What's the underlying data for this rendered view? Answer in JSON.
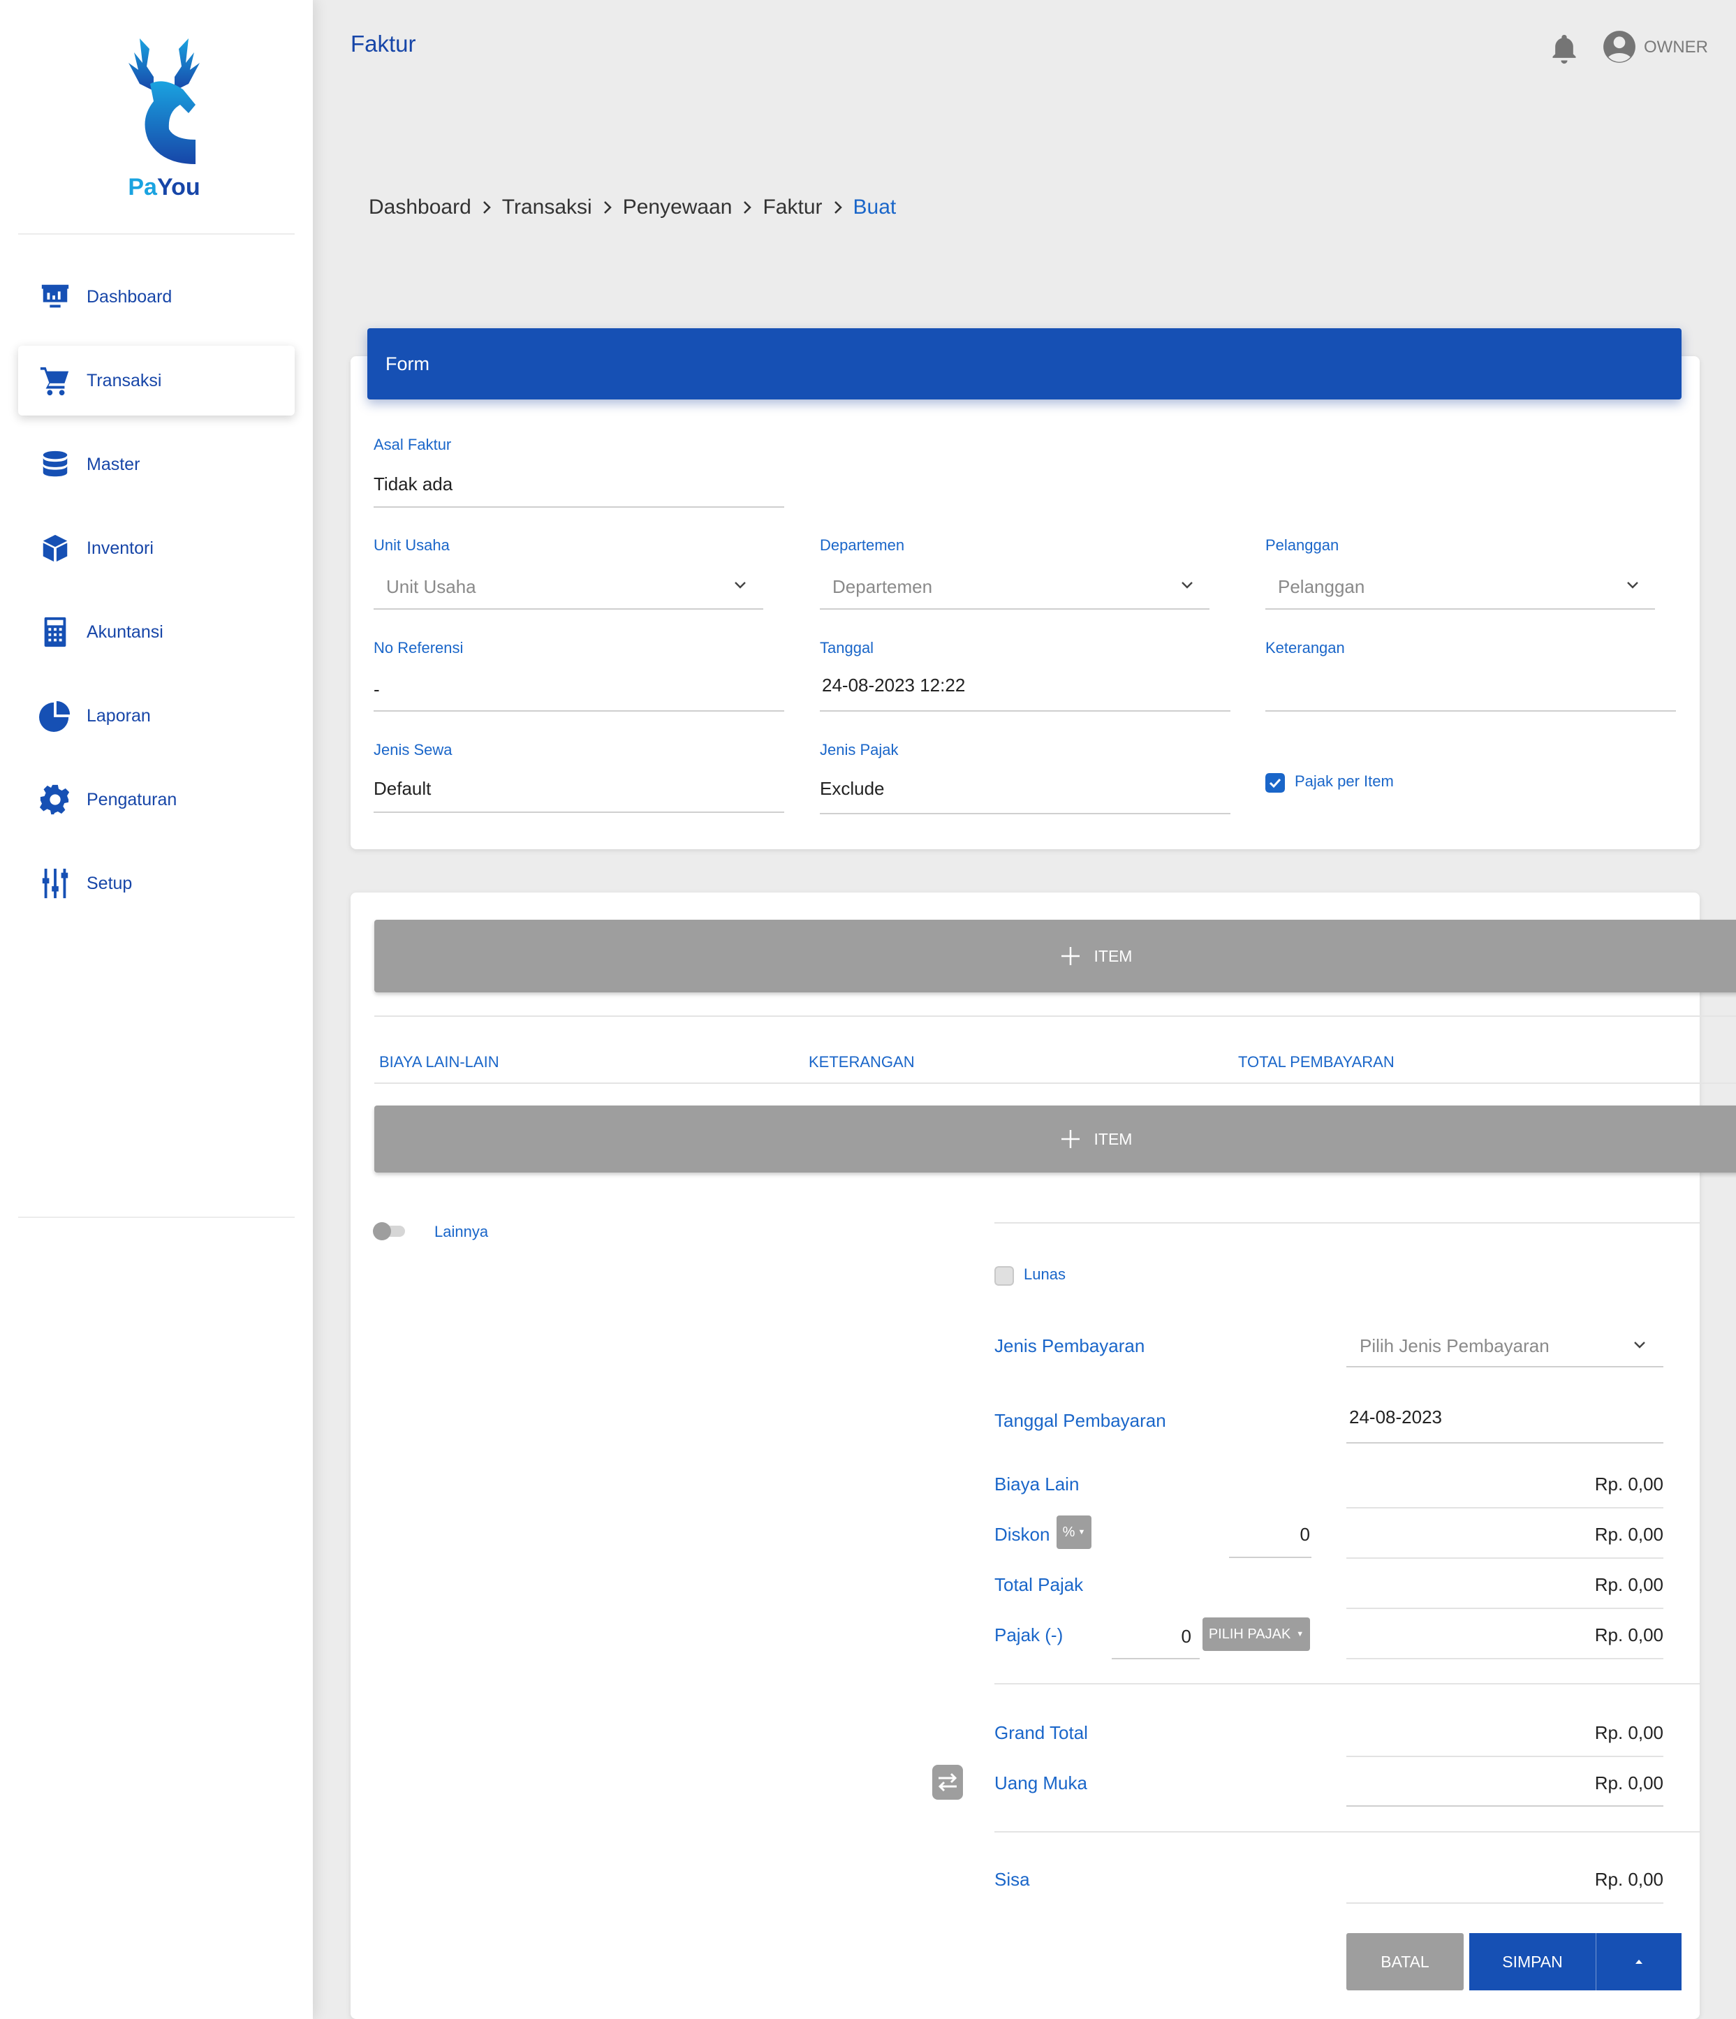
{
  "brand": {
    "part1": "Pa",
    "part2": "You"
  },
  "sidebar": {
    "items": [
      {
        "label": "Dashboard",
        "icon": "dashboard-icon"
      },
      {
        "label": "Transaksi",
        "icon": "cart-icon"
      },
      {
        "label": "Master",
        "icon": "database-icon"
      },
      {
        "label": "Inventori",
        "icon": "box-icon"
      },
      {
        "label": "Akuntansi",
        "icon": "calculator-icon"
      },
      {
        "label": "Laporan",
        "icon": "pie-chart-icon"
      },
      {
        "label": "Pengaturan",
        "icon": "gear-icon"
      },
      {
        "label": "Setup",
        "icon": "sliders-icon"
      }
    ],
    "active": "Transaksi"
  },
  "header": {
    "title": "Faktur",
    "user": "OWNER"
  },
  "breadcrumb": [
    "Dashboard",
    "Transaksi",
    "Penyewaan",
    "Faktur",
    "Buat"
  ],
  "form": {
    "header": "Form",
    "asal_faktur": {
      "label": "Asal Faktur",
      "value": "Tidak ada"
    },
    "unit_usaha": {
      "label": "Unit Usaha",
      "placeholder": "Unit Usaha"
    },
    "departemen": {
      "label": "Departemen",
      "placeholder": "Departemen"
    },
    "pelanggan": {
      "label": "Pelanggan",
      "placeholder": "Pelanggan"
    },
    "no_referensi": {
      "label": "No Referensi",
      "value": "-"
    },
    "tanggal": {
      "label": "Tanggal",
      "value": "24-08-2023 12:22"
    },
    "keterangan": {
      "label": "Keterangan",
      "value": ""
    },
    "jenis_sewa": {
      "label": "Jenis Sewa",
      "value": "Default"
    },
    "jenis_pajak": {
      "label": "Jenis Pajak",
      "value": "Exclude"
    },
    "pajak_per_item": {
      "label": "Pajak per Item",
      "checked": true
    }
  },
  "items": {
    "add_item_label": "ITEM",
    "columns": [
      "BIAYA LAIN-LAIN",
      "KETERANGAN",
      "TOTAL PEMBAYARAN"
    ],
    "add_other_label": "ITEM"
  },
  "lainnya": {
    "label": "Lainnya",
    "enabled": false
  },
  "payment": {
    "lunas": {
      "label": "Lunas",
      "checked": false
    },
    "jenis_pembayaran": {
      "label": "Jenis Pembayaran",
      "placeholder": "Pilih Jenis Pembayaran"
    },
    "tanggal_pembayaran": {
      "label": "Tanggal Pembayaran",
      "value": "24-08-2023"
    },
    "biaya_lain": {
      "label": "Biaya Lain",
      "amount": "Rp. 0,00"
    },
    "diskon": {
      "label": "Diskon",
      "type": "%",
      "value": "0",
      "amount": "Rp. 0,00"
    },
    "total_pajak": {
      "label": "Total Pajak",
      "amount": "Rp. 0,00"
    },
    "pajak": {
      "label": "Pajak (-)",
      "value": "0",
      "button": "PILIH PAJAK",
      "amount": "Rp. 0,00"
    },
    "grand_total": {
      "label": "Grand Total",
      "amount": "Rp. 0,00"
    },
    "uang_muka": {
      "label": "Uang Muka",
      "amount": "Rp. 0,00"
    },
    "sisa": {
      "label": "Sisa",
      "amount": "Rp. 0,00"
    }
  },
  "actions": {
    "batal": "BATAL",
    "simpan": "SIMPAN"
  },
  "colors": {
    "primary": "#1650b4",
    "accent": "#1a66c9",
    "grey_button": "#9e9e9e"
  }
}
